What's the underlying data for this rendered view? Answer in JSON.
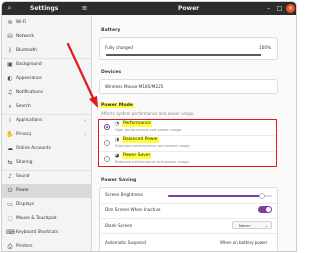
{
  "header": {
    "sidebar_title": "Settings",
    "page_title": "Power"
  },
  "sidebar": {
    "items": [
      {
        "label": "Wi-Fi",
        "icon": "wifi-icon",
        "glyph": "≋",
        "chevron": ""
      },
      {
        "label": "Network",
        "icon": "network-icon",
        "glyph": "⛁",
        "chevron": ""
      },
      {
        "label": "Bluetooth",
        "icon": "bluetooth-icon",
        "glyph": "ᛒ",
        "chevron": ""
      },
      {
        "label": "Background",
        "icon": "background-icon",
        "glyph": "▣",
        "chevron": ""
      },
      {
        "label": "Appearance",
        "icon": "appearance-icon",
        "glyph": "◐",
        "chevron": ""
      },
      {
        "label": "Notifications",
        "icon": "bell-icon",
        "glyph": "♫",
        "chevron": ""
      },
      {
        "label": "Search",
        "icon": "search-icon",
        "glyph": "⌕",
        "chevron": ""
      },
      {
        "label": "Applications",
        "icon": "applications-icon",
        "glyph": "⁞",
        "chevron": "›"
      },
      {
        "label": "Privacy",
        "icon": "privacy-icon",
        "glyph": "✋",
        "chevron": "›"
      },
      {
        "label": "Online Accounts",
        "icon": "cloud-icon",
        "glyph": "☁",
        "chevron": ""
      },
      {
        "label": "Sharing",
        "icon": "sharing-icon",
        "glyph": "⇆",
        "chevron": ""
      },
      {
        "label": "Sound",
        "icon": "speaker-icon",
        "glyph": "♪",
        "chevron": ""
      },
      {
        "label": "Power",
        "icon": "power-icon",
        "glyph": "⏻",
        "chevron": ""
      },
      {
        "label": "Displays",
        "icon": "display-icon",
        "glyph": "▭",
        "chevron": ""
      },
      {
        "label": "Mouse & Touchpad",
        "icon": "mouse-icon",
        "glyph": "◌",
        "chevron": ""
      },
      {
        "label": "Keyboard Shortcuts",
        "icon": "keyboard-icon",
        "glyph": "⌨",
        "chevron": ""
      },
      {
        "label": "Printers",
        "icon": "printer-icon",
        "glyph": "⎙",
        "chevron": ""
      }
    ]
  },
  "battery": {
    "section_title": "Battery",
    "status": "Fully charged",
    "percent_label": "100%",
    "level": 1.0
  },
  "devices": {
    "section_title": "Devices",
    "device_name": "Wireless Mouse M185/M225"
  },
  "power_mode": {
    "section_title": "Power Mode",
    "subtitle": "Affects system performance and power usage.",
    "options": [
      {
        "name": "Performance",
        "desc": "High performance and power usage.",
        "icon": "speedometer-icon",
        "glyph": "◔",
        "selected": true
      },
      {
        "name": "Balanced Power",
        "desc": "Standard performance and power usage.",
        "icon": "balance-icon",
        "glyph": "◑",
        "selected": false
      },
      {
        "name": "Power Saver",
        "desc": "Reduced performance and power usage.",
        "icon": "leaf-icon",
        "glyph": "◕",
        "selected": false
      }
    ]
  },
  "power_saving": {
    "section_title": "Power Saving",
    "screen_brightness_label": "Screen Brightness",
    "screen_brightness_level": 0.9,
    "dim_screen_label": "Dim Screen When Inactive",
    "dim_screen_on": true,
    "blank_screen_label": "Blank Screen",
    "blank_screen_value": "Never",
    "auto_suspend_label": "Automatic Suspend",
    "auto_suspend_value": "When on battery power"
  },
  "colors": {
    "accent": "#7b3fa3",
    "highlight": "#ffff3a",
    "annotation_red": "#e0191d",
    "header": "#2c2c2c"
  }
}
